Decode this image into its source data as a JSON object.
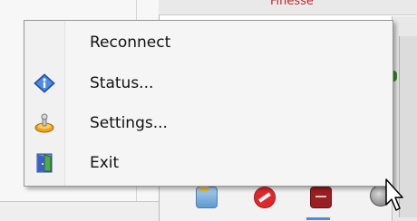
{
  "background": {
    "window_title_fragment": "Finesse"
  },
  "context_menu": {
    "items": [
      {
        "label": "Reconnect",
        "icon": "none"
      },
      {
        "label": "Status...",
        "icon": "info-icon"
      },
      {
        "label": "Settings...",
        "icon": "settings-icon"
      },
      {
        "label": "Exit",
        "icon": "exit-door-icon"
      }
    ]
  },
  "colors": {
    "menu_background": "#f5f5f5",
    "menu_border": "#979797",
    "info_blue": "#2b66c9"
  }
}
